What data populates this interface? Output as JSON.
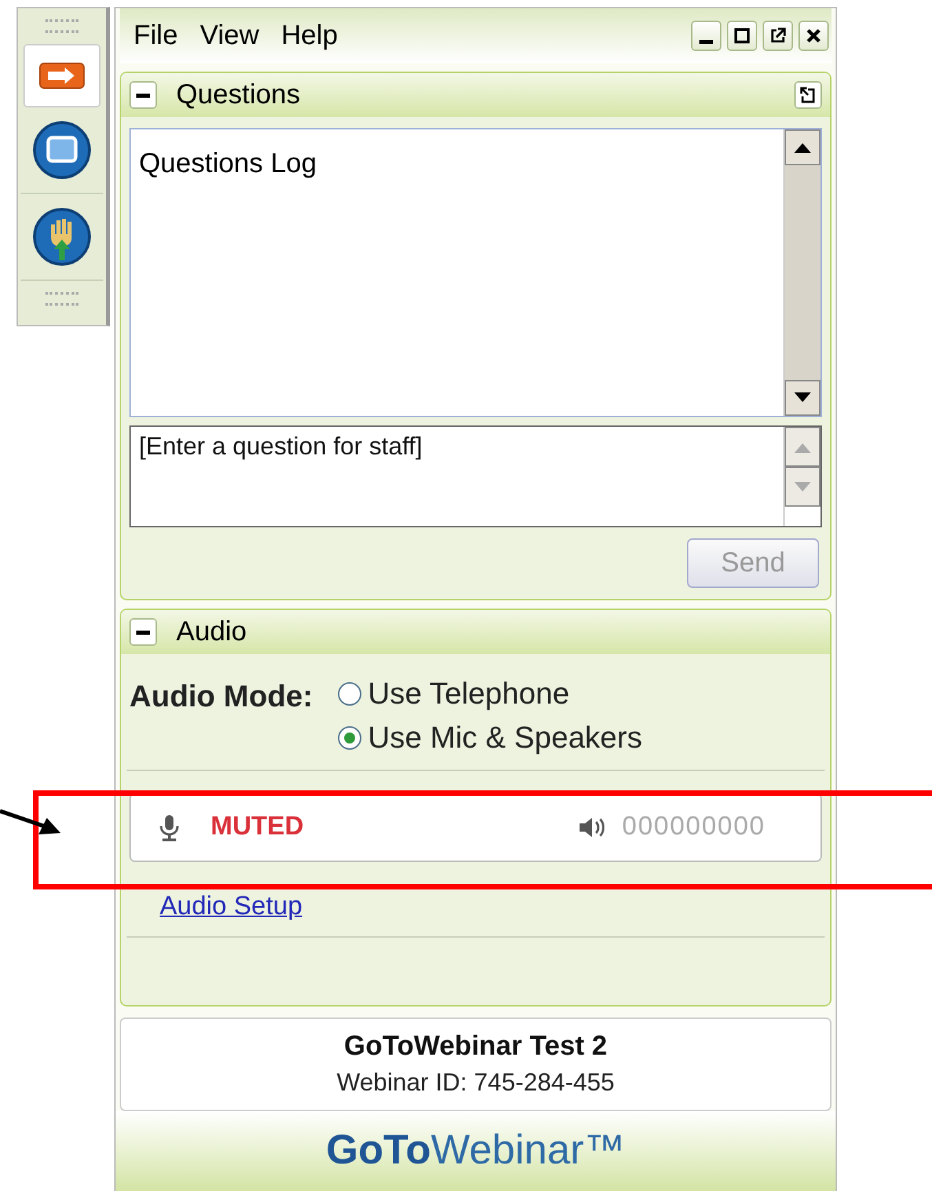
{
  "menu": [
    "File",
    "View",
    "Help"
  ],
  "questions": {
    "title": "Questions",
    "expanded": true,
    "log_title": "Questions Log",
    "input": {
      "placeholder": "[Enter a question for staff]"
    },
    "send": {
      "label": "Send",
      "disabled": true
    }
  },
  "audio": {
    "title": "Audio",
    "expanded": true,
    "mode_label": "Audio Mode:",
    "options": [
      {
        "label": "Use Telephone",
        "selected": false
      },
      {
        "label": "Use Mic & Speakers",
        "selected": true
      }
    ],
    "mic_status": "MUTED",
    "speaker_reading": "000000000",
    "setup_link": "Audio Setup"
  },
  "webinar": {
    "title": "GoToWebinar Test 2",
    "id": "Webinar ID: 745-284-455"
  },
  "logo": "**GoTo**Webinar™"
}
